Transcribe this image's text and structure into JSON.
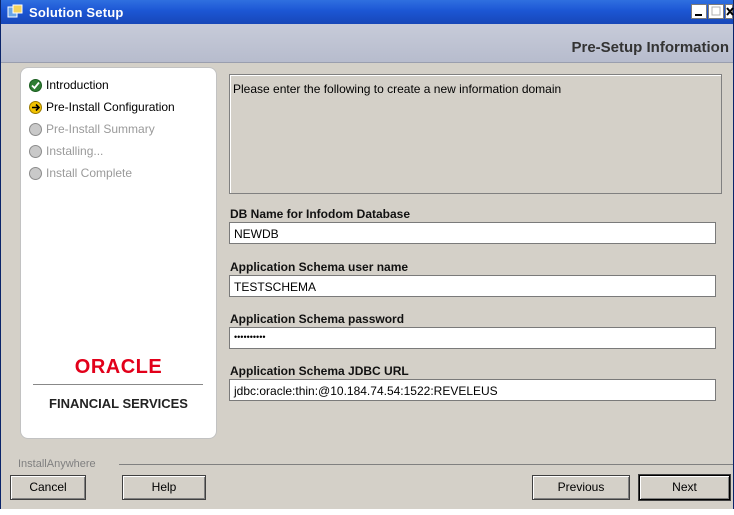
{
  "window": {
    "title": "Solution Setup",
    "banner_title": "Pre-Setup Information"
  },
  "steps": [
    {
      "label": "Introduction",
      "state": "done"
    },
    {
      "label": "Pre-Install Configuration",
      "state": "current"
    },
    {
      "label": "Pre-Install Summary",
      "state": "pending"
    },
    {
      "label": "Installing...",
      "state": "pending"
    },
    {
      "label": "Install Complete",
      "state": "pending"
    }
  ],
  "logo": {
    "oracle": "ORACLE",
    "subtitle": "FINANCIAL SERVICES"
  },
  "info": {
    "text": "Please enter the following to create a new information domain"
  },
  "fields": [
    {
      "label": "DB Name for Infodom Database",
      "value": "NEWDB"
    },
    {
      "label": "Application Schema user name",
      "value": "TESTSCHEMA"
    },
    {
      "label": "Application Schema password",
      "value": "••••••••••"
    },
    {
      "label": "Application Schema JDBC URL",
      "value": "jdbc:oracle:thin:@10.184.74.54:1522:REVELEUS"
    }
  ],
  "footer": {
    "brand": "InstallAnywhere",
    "cancel": "Cancel",
    "help": "Help",
    "previous": "Previous",
    "next": "Next"
  },
  "colors": {
    "titlebar": "#1c56d4",
    "oracle_red": "#e2001a",
    "done": "#2e7d32",
    "current": "#f2c200",
    "pending": "#c9c9c9"
  }
}
